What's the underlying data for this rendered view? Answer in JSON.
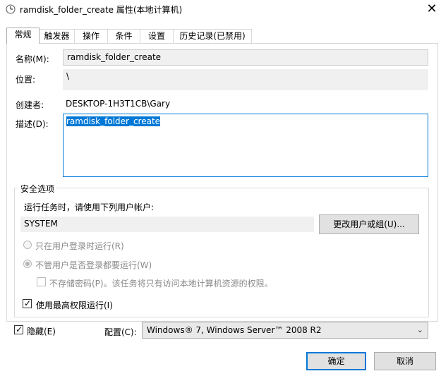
{
  "window": {
    "title": "ramdisk_folder_create 属性(本地计算机)",
    "close_glyph": "✕",
    "title_icon": "clock-icon"
  },
  "tabs": [
    {
      "label": "常规",
      "active": true
    },
    {
      "label": "触发器",
      "active": false
    },
    {
      "label": "操作",
      "active": false
    },
    {
      "label": "条件",
      "active": false
    },
    {
      "label": "设置",
      "active": false
    },
    {
      "label": "历史记录(已禁用)",
      "active": false
    }
  ],
  "general": {
    "name_label": "名称(M):",
    "name_value": "ramdisk_folder_create",
    "location_label": "位置:",
    "location_value": "\\",
    "author_label": "创建者:",
    "author_value": "DESKTOP-1H3T1CB\\Gary",
    "description_label": "描述(D):",
    "description_value": "ramdisk_folder_create"
  },
  "security": {
    "group_title": "安全选项",
    "run_as_prompt": "运行任务时，请使用下列用户帐户:",
    "user_account": "SYSTEM",
    "change_user_button": "更改用户或组(U)...",
    "radio_logged_on_only": "只在用户登录时运行(R)",
    "radio_logged_on_or_not": "不管用户是否登录都要运行(W)",
    "radio_selected": "radio_logged_on_or_not",
    "no_store_password": "不存储密码(P)。该任务将只有访问本地计算机资源的权限。",
    "no_store_password_checked": false,
    "highest_privileges": "使用最高权限运行(I)",
    "highest_privileges_checked": true
  },
  "footer": {
    "hidden_label": "隐藏(E)",
    "hidden_checked": true,
    "configure_label": "配置(C):",
    "configure_value": "Windows® 7, Windows Server™ 2008 R2",
    "ok_button": "确定",
    "cancel_button": "取消"
  },
  "check_glyph": "✓",
  "dropdown_glyph": "⌄",
  "colors": {
    "accent": "#0078d7",
    "readonly_field": "#f0f0f0",
    "button_face": "#e1e1e1",
    "disabled_text": "#8a8a8a"
  }
}
